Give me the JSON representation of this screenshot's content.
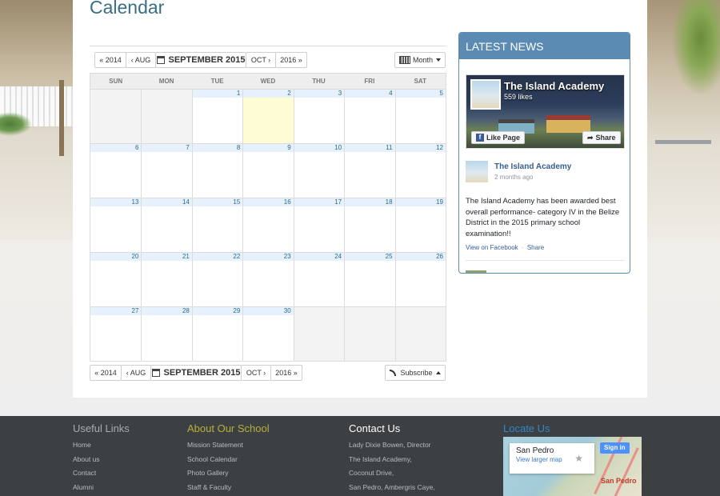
{
  "page": {
    "title": "Calendar"
  },
  "calendar": {
    "toolbar": {
      "prev_year": "« 2014",
      "prev_month": "‹ AUG",
      "current": "SEPTEMBER 2015",
      "next_month": "OCT ›",
      "next_year": "2016 »",
      "view": "Month"
    },
    "subscribe_label": "Subscribe",
    "weekdays": [
      "SUN",
      "MON",
      "TUE",
      "WED",
      "THU",
      "FRI",
      "SAT"
    ],
    "weeks": [
      [
        "",
        "",
        "1",
        "2",
        "3",
        "4",
        "5"
      ],
      [
        "6",
        "7",
        "8",
        "9",
        "10",
        "11",
        "12"
      ],
      [
        "13",
        "14",
        "15",
        "16",
        "17",
        "18",
        "19"
      ],
      [
        "20",
        "21",
        "22",
        "23",
        "24",
        "25",
        "26"
      ],
      [
        "27",
        "28",
        "29",
        "30",
        "",
        "",
        ""
      ]
    ],
    "today": "2"
  },
  "news": {
    "header": "LATEST NEWS",
    "page_name": "The Island Academy",
    "likes": "559 likes",
    "like_button": "Like Page",
    "share_button": "Share",
    "post": {
      "author": "The Island Academy",
      "time": "2 months ago",
      "text": "The Island Academy has been awarded best overall performance- category IV in the Belize District in the 2015 primary school examination!!",
      "view_link": "View on Facebook",
      "separator": "·",
      "share_link": "Share"
    }
  },
  "footer": {
    "useful_links": {
      "title": "Useful Links",
      "items": [
        "Home",
        "About us",
        "Contact",
        "Alumni"
      ]
    },
    "about": {
      "title": "About Our School",
      "items": [
        "Mission Statement",
        "School Calendar",
        "Photo Gallery",
        "Staff & Faculty"
      ]
    },
    "contact": {
      "title": "Contact Us",
      "items": [
        "Lady Dixie Bowen, Director",
        "The Island Academy,",
        "Coconut Drive,",
        "San Pedro, Ambergris Caye,"
      ]
    },
    "locate": {
      "title": "Locate Us",
      "place": "San Pedro",
      "larger_map": "View larger map",
      "sign_in": "Sign in",
      "map_label": "San Pedro"
    }
  },
  "colors": {
    "title": "#3a6e84",
    "news_header": "#5b8bb3",
    "footer_bg": "#3d4043",
    "today": "#fdfcd4",
    "date_strip": "#e6f1fb"
  }
}
